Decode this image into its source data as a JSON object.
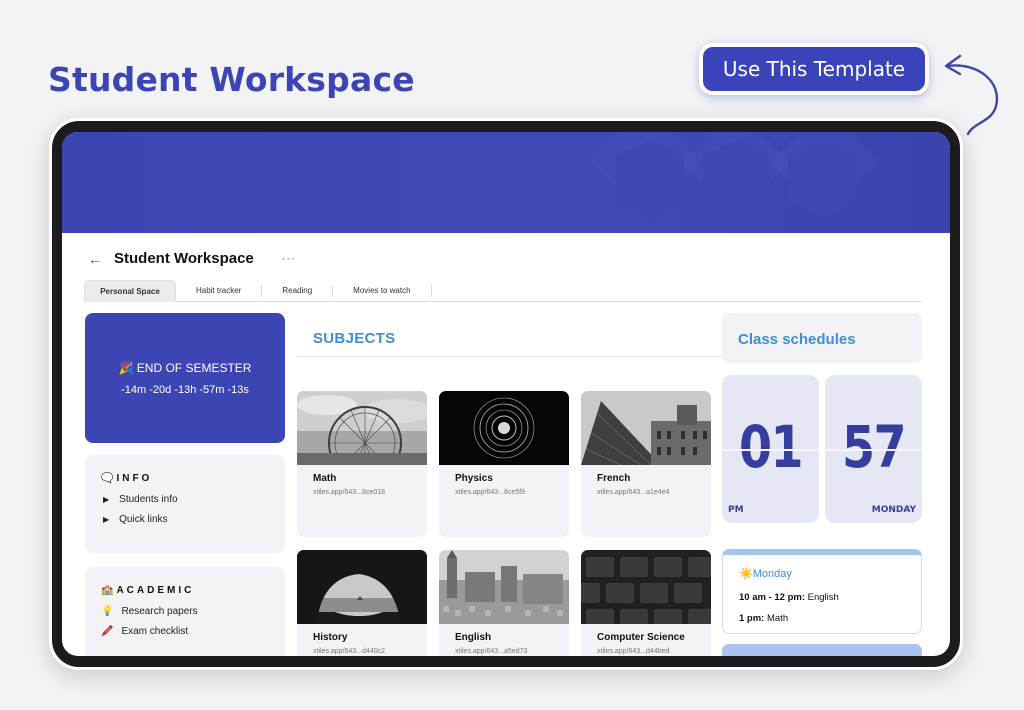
{
  "page": {
    "title": "Student Workspace",
    "cta_label": "Use This Template"
  },
  "workspace": {
    "back_icon": "back-arrow-icon",
    "title": "Student Workspace",
    "more": "···"
  },
  "tabs": [
    {
      "label": "Personal Space",
      "active": true
    },
    {
      "label": "Habit tracker",
      "active": false
    },
    {
      "label": "Reading",
      "active": false
    },
    {
      "label": "Movies to watch",
      "active": false
    }
  ],
  "countdown": {
    "title": "🎉 END OF SEMESTER",
    "time": "-14m -20d -13h -57m -13s"
  },
  "info": {
    "heading": "🗨️INFO",
    "items": [
      "Students info",
      "Quick links"
    ]
  },
  "academic": {
    "heading": "🏫ACADEMIC",
    "items": [
      {
        "emoji": "💡",
        "label": "Research papers"
      },
      {
        "emoji": "🖍️",
        "label": "Exam checklist"
      }
    ]
  },
  "subjects": {
    "heading": "SUBJECTS",
    "cards": [
      {
        "name": "Math",
        "url": "xtiles.app/643...8ce018",
        "image": "ferris-wheel"
      },
      {
        "name": "Physics",
        "url": "xtiles.app/643...8ce5f9",
        "image": "rings"
      },
      {
        "name": "French",
        "url": "xtiles.app/643...a1e4e4",
        "image": "louvre"
      },
      {
        "name": "History",
        "url": "xtiles.app/643...d440c2",
        "image": "cave"
      },
      {
        "name": "English",
        "url": "xtiles.app/643...a5ed73",
        "image": "london"
      },
      {
        "name": "Computer Science",
        "url": "xtiles.app/643...d44bed",
        "image": "keyboard"
      }
    ]
  },
  "schedule": {
    "heading": "Class schedules",
    "clock": {
      "hours": "01",
      "minutes": "57",
      "period": "PM",
      "day": "MONDAY"
    },
    "day": {
      "title": "☀️Monday",
      "rows": [
        {
          "time": "10 am - 12 pm:",
          "subject": "English"
        },
        {
          "time": "1 pm:",
          "subject": "Math"
        }
      ]
    }
  },
  "colors": {
    "brand": "#3b45b4",
    "accent_blue": "#3f8ed8",
    "card_bg": "#f2f2f7"
  }
}
